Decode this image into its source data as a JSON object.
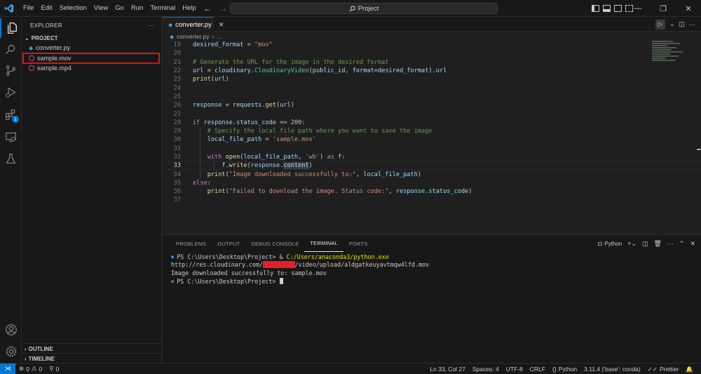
{
  "menu": [
    "File",
    "Edit",
    "Selection",
    "View",
    "Go",
    "Run",
    "Terminal",
    "Help"
  ],
  "search": {
    "label": "Project"
  },
  "sidebar": {
    "title": "EXPLORER",
    "more": "···",
    "section": "PROJECT",
    "files": [
      {
        "name": "converter.py",
        "type": "python"
      },
      {
        "name": "sample.mov",
        "type": "video",
        "highlighted": true
      },
      {
        "name": "sample.mp4",
        "type": "video"
      }
    ],
    "outline": "OUTLINE",
    "timeline": "TIMELINE"
  },
  "activity": {
    "extensions_badge": "1"
  },
  "editor": {
    "tab": "converter.py",
    "breadcrumb": [
      "converter.py",
      "..."
    ],
    "lines": [
      {
        "n": "19",
        "html": "<span class=\"vr\">desired_format</span> = <span class=\"str\">\"mov\"</span>"
      },
      {
        "n": "20",
        "html": ""
      },
      {
        "n": "21",
        "html": "<span class=\"cm\"># Generate the URL for the image in the desired format</span>"
      },
      {
        "n": "22",
        "html": "<span class=\"vr\">url</span> = <span class=\"vr\">cloudinary</span>.<span class=\"cls\">CloudinaryVideo</span>(<span class=\"vr\">public_id</span>, <span class=\"vr\">format</span>=<span class=\"vr\">desired_format</span>).<span class=\"vr\">url</span>"
      },
      {
        "n": "23",
        "html": "<span class=\"fn\">print</span>(<span class=\"vr\">url</span>)"
      },
      {
        "n": "24",
        "html": ""
      },
      {
        "n": "25",
        "html": ""
      },
      {
        "n": "26",
        "html": "<span class=\"vr\">response</span> = <span class=\"vr\">requests</span>.<span class=\"fn\">get</span>(<span class=\"vr\">url</span>)"
      },
      {
        "n": "27",
        "html": ""
      },
      {
        "n": "28",
        "html": "<span class=\"kw\">if</span> <span class=\"vr\">response</span>.<span class=\"vr\">status_code</span> == <span class=\"nm\">200</span>:"
      },
      {
        "n": "29",
        "html": "    <span class=\"cm\"># Specify the local file path where you want to save the image</span>"
      },
      {
        "n": "30",
        "html": "    <span class=\"vr\">local_file_path</span> = <span class=\"str\">'sample.mov'</span>"
      },
      {
        "n": "31",
        "html": ""
      },
      {
        "n": "32",
        "html": "    <span class=\"kw\">with</span> <span class=\"fn\">open</span>(<span class=\"vr\">local_file_path</span>, <span class=\"str\">'wb'</span>) <span class=\"kw\">as</span> <span class=\"vr\">f</span>:"
      },
      {
        "n": "33",
        "html": "        <span class=\"vr\">f</span>.<span class=\"fn\">write</span>(<span class=\"vr\">response</span>.<span class=\"vr sel\">content</span>)",
        "current": true
      },
      {
        "n": "34",
        "html": "    <span class=\"fn\">print</span>(<span class=\"str\">\"Image downloaded successfully to:\"</span>, <span class=\"vr\">local_file_path</span>)"
      },
      {
        "n": "35",
        "html": "<span class=\"kw\">else</span>:"
      },
      {
        "n": "36",
        "html": "    <span class=\"fn\">print</span>(<span class=\"str\">\"Failed to download the image. Status code:\"</span>, <span class=\"vr\">response</span>.<span class=\"vr\">status_code</span>)"
      },
      {
        "n": "37",
        "html": ""
      }
    ]
  },
  "panel": {
    "tabs": [
      "PROBLEMS",
      "OUTPUT",
      "DEBUG CONSOLE",
      "TERMINAL",
      "PORTS"
    ],
    "active_tab": "TERMINAL",
    "terminal_name": "Python",
    "terminal": {
      "prompt1": "PS C:\\Users\\Desktop\\Project> ",
      "cmd_amp": "& ",
      "cmd_path": "C:/Users/anaconda3/python.exe",
      "url_start": "http://res.cloudinary.com/",
      "url_redacted": "xxxxxxxxx",
      "url_end": "/video/upload/aldgatkeuyavtmqw4lfd.mov",
      "success": "Image downloaded successfully to: sample.mov",
      "prompt2": "PS C:\\Users\\Desktop\\Project> "
    }
  },
  "status": {
    "errors": "0",
    "warnings": "0",
    "ports": "0",
    "position": "Ln 33, Col 27",
    "spaces": "Spaces: 4",
    "encoding": "UTF-8",
    "eol": "CRLF",
    "language": "Python",
    "interpreter": "3.11.4 ('base': conda)",
    "formatter": "Prettier"
  },
  "colors": {
    "accent": "#0078d4",
    "highlight_box": "#d11a1a",
    "redaction": "#e3202a"
  }
}
